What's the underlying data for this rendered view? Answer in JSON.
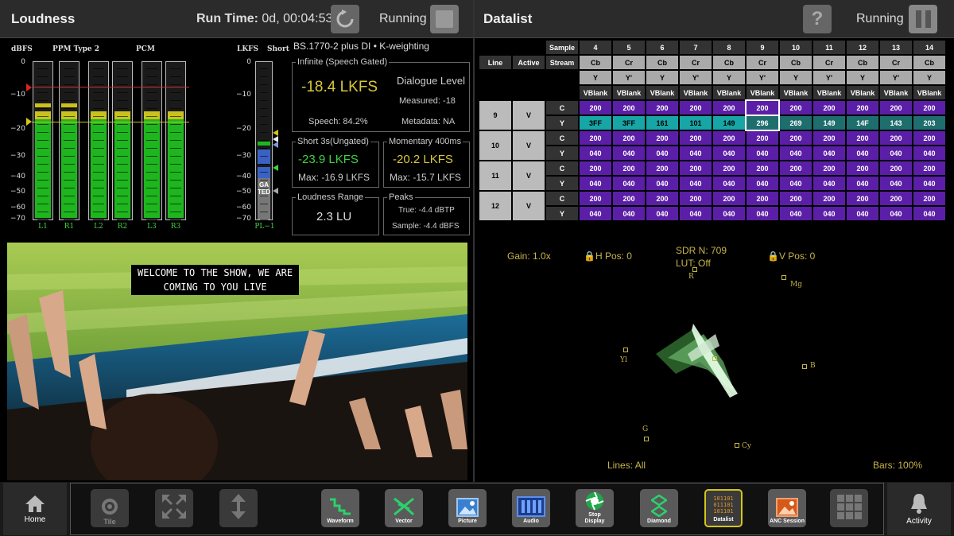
{
  "loudness": {
    "title": "Loudness",
    "run_time_label": "Run Time:",
    "run_time_value": "0d, 00:04:53",
    "status": "Running",
    "scale_dbfs_label": "dBFS",
    "ppm_label": "PPM Type 2",
    "pcm_label": "PCM",
    "lkfs_label": "LKFS",
    "short_label": "Short",
    "standard": "BS.1770-2 plus DI • K-weighting",
    "scale_left": [
      "0",
      "−10",
      "−20",
      "−30",
      "−40",
      "−50",
      "−60",
      "−70"
    ],
    "scale_right": [
      "0",
      "−10",
      "−20",
      "−30",
      "−40",
      "−50",
      "−60",
      "−70"
    ],
    "channels": [
      "L1",
      "R1",
      "L2",
      "R2",
      "L3",
      "R3"
    ],
    "pl_label": "PL−1",
    "gated_label": "GATED",
    "infinite": {
      "caption": "Infinite (Speech Gated)",
      "value": "-18.4 LKFS",
      "dialogue": "Dialogue Level",
      "measured": "Measured: -18",
      "speech": "Speech: 84.2%",
      "metadata": "Metadata: NA"
    },
    "short": {
      "caption": "Short 3s(Ungated)",
      "value": "-23.9 LKFS",
      "max": "Max: -16.9 LKFS"
    },
    "momentary": {
      "caption": "Momentary 400ms",
      "value": "-20.2 LKFS",
      "max": "Max: -15.7 LKFS"
    },
    "range": {
      "caption": "Loudness Range",
      "value": "2.3 LU"
    },
    "peaks": {
      "caption": "Peaks",
      "true": "True: -4.4 dBTP",
      "sample": "Sample: -4.4 dBFS"
    }
  },
  "picture": {
    "caption_line1": "WELCOME TO THE SHOW, WE ARE",
    "caption_line2": "COMING TO YOU LIVE"
  },
  "datalist": {
    "title": "Datalist",
    "status": "Running",
    "sample_label": "Sample",
    "stream_label": "Stream",
    "line_label": "Line",
    "active_label": "Active",
    "samples": [
      "4",
      "5",
      "6",
      "7",
      "8",
      "9",
      "10",
      "11",
      "12",
      "13",
      "14"
    ],
    "streams": [
      "Cb",
      "Cr",
      "Cb",
      "Cr",
      "Cb",
      "Cr",
      "Cb",
      "Cr",
      "Cb",
      "Cr",
      "Cb"
    ],
    "components": [
      "Y",
      "Y'",
      "Y",
      "Y'",
      "Y",
      "Y'",
      "Y",
      "Y'",
      "Y",
      "Y'",
      "Y"
    ],
    "vblank": [
      "VBlank",
      "VBlank",
      "VBlank",
      "VBlank",
      "VBlank",
      "VBlank",
      "VBlank",
      "VBlank",
      "VBlank",
      "VBlank",
      "VBlank"
    ],
    "rows": [
      {
        "line": "9",
        "active": "V",
        "c": [
          "200",
          "200",
          "200",
          "200",
          "200",
          "200",
          "200",
          "200",
          "200",
          "200",
          "200"
        ],
        "y": [
          "3FF",
          "3FF",
          "161",
          "101",
          "149",
          "296",
          "269",
          "149",
          "14F",
          "143",
          "203"
        ]
      },
      {
        "line": "10",
        "active": "V",
        "c": [
          "200",
          "200",
          "200",
          "200",
          "200",
          "200",
          "200",
          "200",
          "200",
          "200",
          "200"
        ],
        "y": [
          "040",
          "040",
          "040",
          "040",
          "040",
          "040",
          "040",
          "040",
          "040",
          "040",
          "040"
        ]
      },
      {
        "line": "11",
        "active": "V",
        "c": [
          "200",
          "200",
          "200",
          "200",
          "200",
          "200",
          "200",
          "200",
          "200",
          "200",
          "200"
        ],
        "y": [
          "040",
          "040",
          "040",
          "040",
          "040",
          "040",
          "040",
          "040",
          "040",
          "040",
          "040"
        ]
      },
      {
        "line": "12",
        "active": "V",
        "c": [
          "200",
          "200",
          "200",
          "200",
          "200",
          "200",
          "200",
          "200",
          "200",
          "200",
          "200"
        ],
        "y": [
          "040",
          "040",
          "040",
          "040",
          "040",
          "040",
          "040",
          "040",
          "040",
          "040",
          "040"
        ]
      }
    ],
    "c_label": "C",
    "y_label": "Y"
  },
  "vector": {
    "gain": "Gain: 1.0x",
    "hpos": "H Pos: 0",
    "sdr": "SDR N: 709",
    "lut": "LUT: Off",
    "vpos": "V Pos: 0",
    "lines": "Lines: All",
    "bars": "Bars: 100%",
    "targets": {
      "r": "R",
      "mg": "Mg",
      "b": "B",
      "cy": "Cy",
      "g": "G",
      "yl": "Yl"
    }
  },
  "toolbar": {
    "home": "Home",
    "tile": "Tile",
    "waveform": "Waveform",
    "vector": "Vector",
    "picture": "Picture",
    "audio": "Audio",
    "stop_display": "Stop Display",
    "diamond": "Diamond",
    "datalist": "Datalist",
    "anc_session": "ANC Session",
    "activity": "Activity",
    "datalist_icon_text": "101101\n011101\n101101"
  },
  "colors": {
    "meter_green": "#1eb51e",
    "meter_yellow": "#c9c21e",
    "datalist_purple": "#5a1fa6",
    "vector_gold": "#c8b54a",
    "selected_tool": "#d4c41a"
  }
}
